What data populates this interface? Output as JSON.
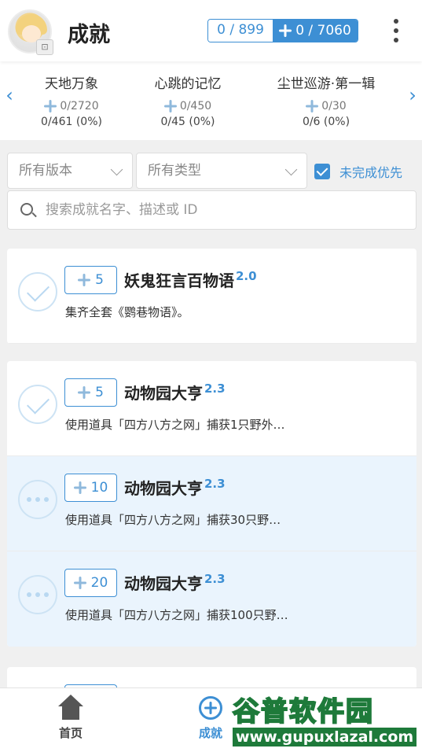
{
  "header": {
    "title": "成就",
    "score_achievements": "0 / 899",
    "score_primogems": "0 / 7060"
  },
  "categories": [
    {
      "name": "天地万象",
      "primogems": "0/2720",
      "count": "0/461 (0%)"
    },
    {
      "name": "心跳的记忆",
      "primogems": "0/450",
      "count": "0/45 (0%)"
    },
    {
      "name": "尘世巡游·第一辑",
      "primogems": "0/30",
      "count": "0/6 (0%)"
    }
  ],
  "filters": {
    "version_select": "所有版本",
    "type_select": "所有类型",
    "incomplete_first_label": "未完成优先",
    "incomplete_first_checked": true,
    "search_placeholder": "搜索成就名字、描述或 ID"
  },
  "achievements": [
    {
      "reward": "5",
      "title": "妖鬼狂言百物语",
      "version": "2.0",
      "desc": "集齐全套《鹦巷物语》。",
      "status": "done"
    },
    {
      "reward": "5",
      "title": "动物园大亨",
      "version": "2.3",
      "desc": "使用道具「四方八方之网」捕获1只野外…",
      "status": "done"
    },
    {
      "reward": "10",
      "title": "动物园大亨",
      "version": "2.3",
      "desc": "使用道具「四方八方之网」捕获30只野…",
      "status": "pending"
    },
    {
      "reward": "20",
      "title": "动物园大亨",
      "version": "2.3",
      "desc": "使用道具「四方八方之网」捕获100只野…",
      "status": "pending"
    }
  ],
  "tabs": {
    "home": "首页",
    "achievements": "成就"
  },
  "watermark": {
    "top": "谷普软件园",
    "bottom": "www.gupuxlazal.com"
  },
  "colors": {
    "accent": "#3d8fd4",
    "highlight_row": "#eaf4fd"
  },
  "icons": [
    "avatar",
    "more-vert-icon",
    "primogem-icon",
    "chevron-left-icon",
    "chevron-right-icon",
    "search-icon",
    "check-icon",
    "ellipsis-icon",
    "home-icon",
    "achievement-icon"
  ]
}
